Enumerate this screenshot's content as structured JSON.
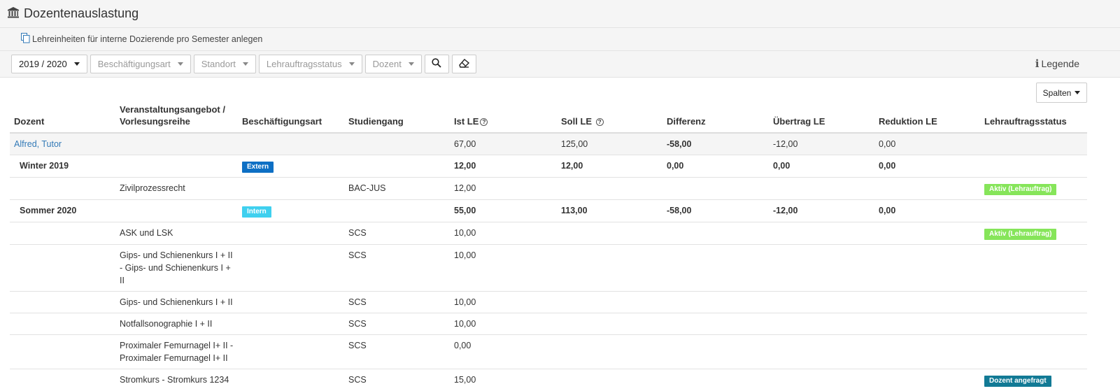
{
  "header": {
    "title": "Dozentenauslastung",
    "icon": "bank-icon"
  },
  "subbar": {
    "link_label": "Lehreinheiten für interne Dozierende pro Semester anlegen",
    "icon": "copy-icon"
  },
  "filters": {
    "year": "2019 / 2020",
    "beschaeftigungsart": "Beschäftigungsart",
    "standort": "Standort",
    "lehrauftragsstatus": "Lehrauftragsstatus",
    "dozent": "Dozent",
    "search_icon": "search-icon",
    "clear_icon": "eraser-icon",
    "legende_icon": "info-icon",
    "legende": "Legende"
  },
  "spalten_label": "Spalten",
  "columns": {
    "dozent": "Dozent",
    "veranstaltung_line1": "Veranstaltungsangebot /",
    "veranstaltung_line2": "Vorlesungsreihe",
    "beschaeftigungsart": "Beschäftigungsart",
    "studiengang": "Studiengang",
    "ist_le": "Ist LE",
    "soll_le": "Soll LE",
    "differenz": "Differenz",
    "uebertrag_le": "Übertrag LE",
    "reduktion_le": "Reduktion LE",
    "lehrauftragsstatus": "Lehrauftragsstatus"
  },
  "colors": {
    "extern": "#0d6fc4",
    "intern": "#3fd0ef",
    "aktiv": "#86e55a",
    "angefragt": "#127a95",
    "negative": "#e00000",
    "positive": "#1f8a1f"
  },
  "rows": {
    "dozent": {
      "name": "Alfred, Tutor",
      "ist": "67,00",
      "soll": "125,00",
      "differenz": "-58,00",
      "uebertrag": "-12,00",
      "reduktion": "0,00"
    },
    "winter": {
      "name": "Winter 2019",
      "art": "Extern",
      "ist": "12,00",
      "soll": "12,00",
      "differenz": "0,00",
      "uebertrag": "0,00",
      "reduktion": "0,00"
    },
    "zivil": {
      "veranstaltung": "Zivilprozessrecht",
      "studiengang": "BAC-JUS",
      "ist": "12,00",
      "status": "Aktiv (Lehrauftrag)"
    },
    "sommer": {
      "name": "Sommer 2020",
      "art": "Intern",
      "ist": "55,00",
      "soll": "113,00",
      "differenz": "-58,00",
      "uebertrag": "-12,00",
      "reduktion": "0,00"
    },
    "ask": {
      "veranstaltung": "ASK und LSK",
      "studiengang": "SCS",
      "ist": "10,00",
      "status": "Aktiv (Lehrauftrag)"
    },
    "gips1": {
      "veranstaltung": "Gips- und Schienenkurs I + II - Gips- und Schienenkurs I + II",
      "studiengang": "SCS",
      "ist": "10,00"
    },
    "gips2": {
      "veranstaltung": "Gips- und Schienenkurs I + II",
      "studiengang": "SCS",
      "ist": "10,00"
    },
    "notfall": {
      "veranstaltung": "Notfallsonographie I + II",
      "studiengang": "SCS",
      "ist": "10,00"
    },
    "femur": {
      "veranstaltung": "Proximaler Femurnagel I+ II - Proximaler Femurnagel I+ II",
      "studiengang": "SCS",
      "ist": "0,00"
    },
    "strom": {
      "veranstaltung": "Stromkurs - Stromkurs 1234",
      "studiengang": "SCS",
      "ist": "15,00",
      "status": "Dozent angefragt"
    }
  }
}
